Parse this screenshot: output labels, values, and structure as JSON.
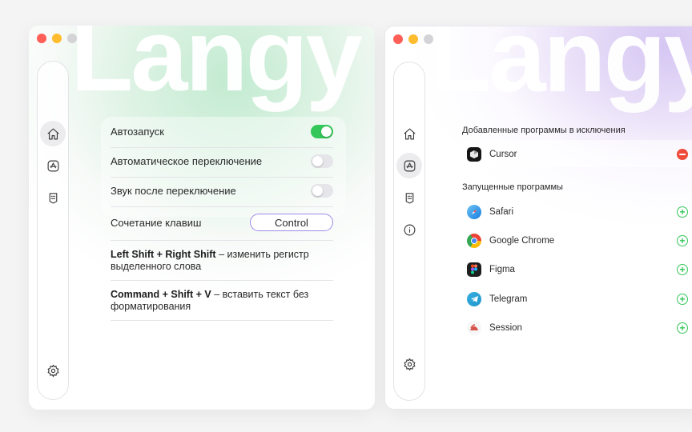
{
  "brand": "Langy",
  "left_window": {
    "settings": [
      {
        "label": "Автозапуск",
        "state": "on"
      },
      {
        "label": "Автоматическое переключение",
        "state": "off"
      },
      {
        "label": "Звук после переключение",
        "state": "off"
      }
    ],
    "hotkey": {
      "label": "Сочетание клавиш",
      "value": "Control"
    },
    "shortcuts": [
      {
        "keys": "Left Shift + Right Shift",
        "dash": " – ",
        "text": "изменить регистр выделенного слова"
      },
      {
        "keys": "Command + Shift + V",
        "dash": " – ",
        "text": "вставить текст без форматирования"
      }
    ]
  },
  "right_window": {
    "excluded_title": "Добавленные программы в исключения",
    "excluded": [
      {
        "name": "Cursor",
        "icon": "cursor-app-icon"
      }
    ],
    "running_title": "Запущенные программы",
    "running": [
      {
        "name": "Safari",
        "icon": "safari-app-icon"
      },
      {
        "name": "Google Chrome",
        "icon": "chrome-app-icon"
      },
      {
        "name": "Figma",
        "icon": "figma-app-icon"
      },
      {
        "name": "Telegram",
        "icon": "telegram-app-icon"
      },
      {
        "name": "Session",
        "icon": "session-app-icon"
      }
    ]
  },
  "sidebar_icons": [
    "home-icon",
    "appstore-icon",
    "keyboard-icon",
    "info-icon",
    "gear-icon"
  ],
  "colors": {
    "toggle_on": "#34c759",
    "accent": "#9f8ae6",
    "remove": "#ef4b3a",
    "add": "#34c759"
  }
}
